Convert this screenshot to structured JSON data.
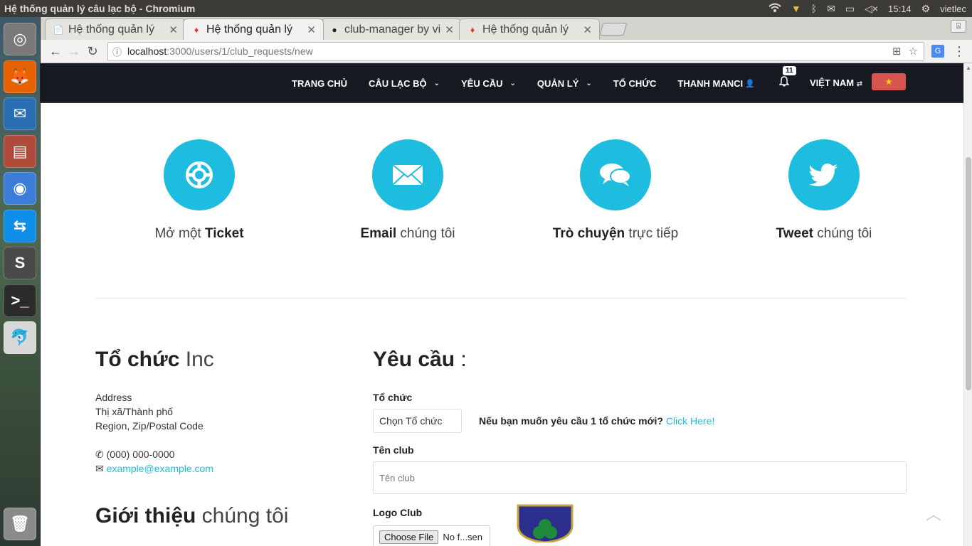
{
  "os_panel": {
    "window_title": "Hệ thống quản lý câu lạc bộ - Chromium",
    "clock": "15:14",
    "user": "vietlec"
  },
  "launcher": {
    "apps": [
      {
        "name": "ubuntu-dash-icon",
        "glyph": "◎",
        "color": "#7a7a7a"
      },
      {
        "name": "firefox-icon",
        "glyph": "🦊",
        "color": "#e66000"
      },
      {
        "name": "thunderbird-icon",
        "glyph": "✉",
        "color": "#2a6db0"
      },
      {
        "name": "files-icon",
        "glyph": "▤",
        "color": "#b04a3a"
      },
      {
        "name": "chromium-icon",
        "glyph": "◉",
        "color": "#3b7dd8"
      },
      {
        "name": "teamviewer-icon",
        "glyph": "⇆",
        "color": "#0e8ee9"
      },
      {
        "name": "sublime-text-icon",
        "glyph": "S",
        "color": "#4a4a4a"
      },
      {
        "name": "terminal-icon",
        "glyph": ">_",
        "color": "#2b2b2b"
      },
      {
        "name": "mysql-workbench-icon",
        "glyph": "🐬",
        "color": "#d8d8d8"
      },
      {
        "name": "trash-icon",
        "glyph": "🗑",
        "color": "#8a8a8a"
      }
    ]
  },
  "browser": {
    "tabs": [
      {
        "label": "Hệ thống quản lý",
        "favicon": "📄"
      },
      {
        "label": "Hệ thống quản lý",
        "favicon": "♦"
      },
      {
        "label": "club-manager by vie",
        "favicon": "●"
      },
      {
        "label": "Hệ thống quản lý",
        "favicon": "♦"
      }
    ],
    "url_host": "localhost",
    "url_path": ":3000/users/1/club_requests/new"
  },
  "site_nav": {
    "items": [
      {
        "label": "TRANG CHỦ",
        "dropdown": false
      },
      {
        "label": "CÂU LẠC BỘ",
        "dropdown": true
      },
      {
        "label": "YÊU CẦU",
        "dropdown": true
      },
      {
        "label": "QUẢN LÝ",
        "dropdown": true
      },
      {
        "label": "TỔ CHỨC",
        "dropdown": false
      },
      {
        "label": "THANH MANCI",
        "dropdown": false
      }
    ],
    "notification_count": "11",
    "language": "VIỆT NAM",
    "flag_star": "★"
  },
  "features": [
    {
      "prefix": "Mở một ",
      "bold": "Ticket",
      "suffix": "",
      "icon": "lifebuoy-icon"
    },
    {
      "prefix": "",
      "bold": "Email",
      "suffix": " chúng tôi",
      "icon": "envelope-icon"
    },
    {
      "prefix": "",
      "bold": "Trò chuyện",
      "suffix": " trực tiếp",
      "icon": "chat-icon"
    },
    {
      "prefix": "",
      "bold": "Tweet",
      "suffix": " chúng tôi",
      "icon": "twitter-icon"
    }
  ],
  "org": {
    "title_bold": "Tổ chức",
    "title_light": " Inc",
    "address_lines": [
      "Address",
      "Thị xã/Thành phố",
      "Region, Zip/Postal Code"
    ],
    "phone": "(000) 000-0000",
    "email": "example@example.com",
    "about_bold": "Giới thiệu",
    "about_light": " chúng tôi"
  },
  "form": {
    "title": "Yêu cầu",
    "colon": " :",
    "org_label": "Tổ chức",
    "org_select_value": "Chọn Tổ chức",
    "org_hint": "Nếu bạn muốn yêu cầu 1 tổ chức mới?",
    "org_hint_link": "Click Here!",
    "name_label": "Tên club",
    "name_placeholder": "Tên club",
    "logo_label": "Logo Club",
    "file_button": "Choose File",
    "file_name": "No f...sen"
  },
  "colors": {
    "accent": "#1ebde0",
    "nav_bg": "#171a20",
    "flag_red": "#d9534f"
  }
}
